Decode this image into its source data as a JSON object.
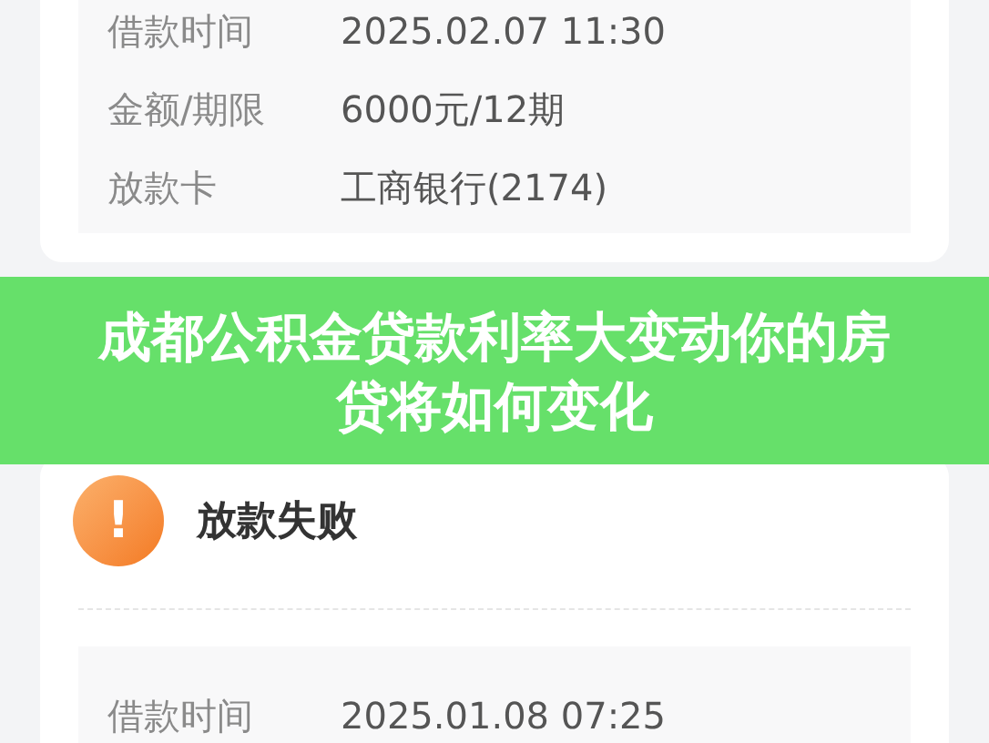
{
  "top_card": {
    "rows": [
      {
        "label": "借款时间",
        "value": "2025.02.07 11:30"
      },
      {
        "label": "金额/期限",
        "value": "6000元/12期"
      },
      {
        "label": "放款卡",
        "value": "工商银行(2174)"
      }
    ]
  },
  "banner": {
    "title": "成都公积金贷款利率大变动你的房贷将如何变化"
  },
  "status_card": {
    "title": "放款失败",
    "icon": "!",
    "rows": [
      {
        "label": "借款时间",
        "value": "2025.01.08 07:25"
      }
    ]
  }
}
